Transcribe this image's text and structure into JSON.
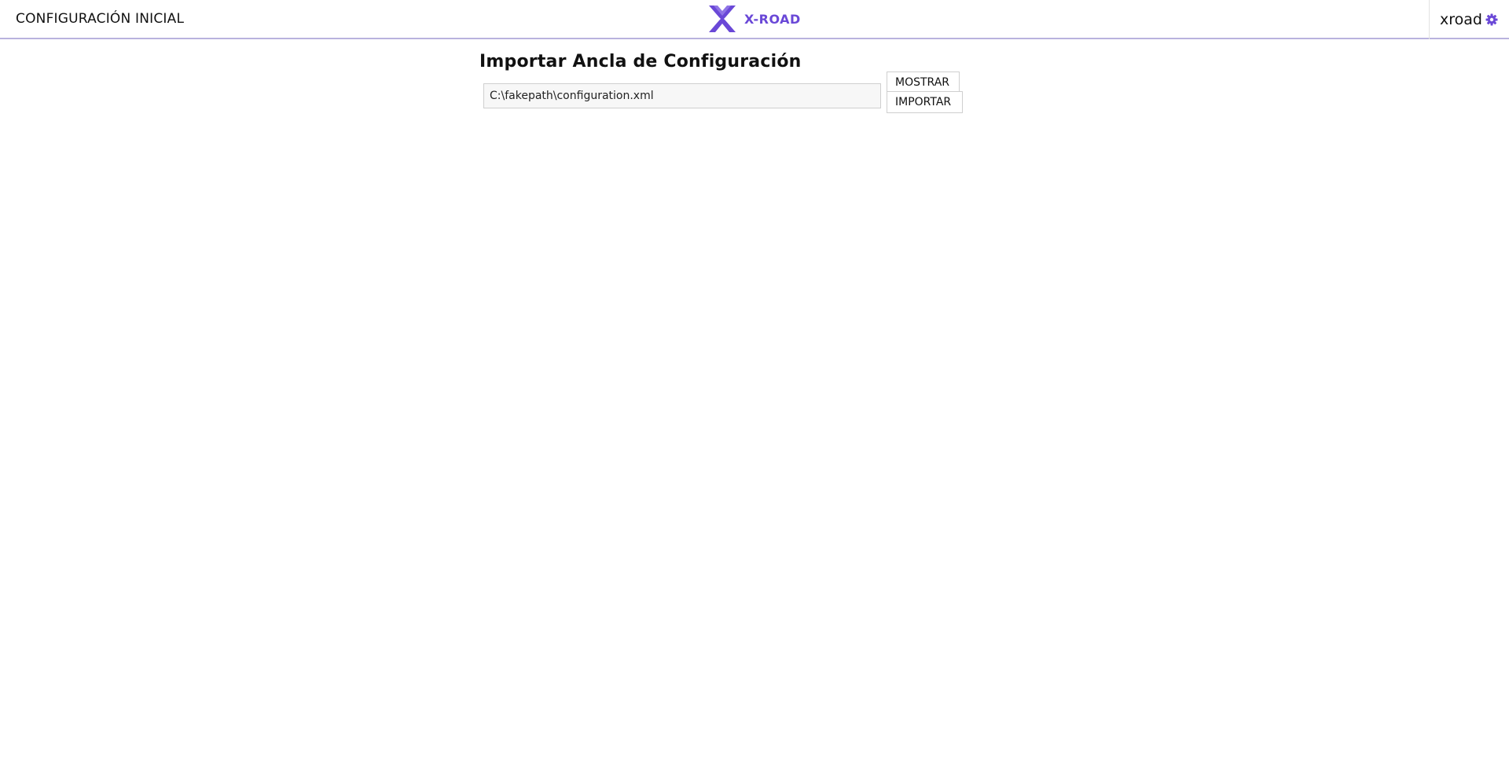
{
  "header": {
    "title": "CONFIGURACIÓN INICIAL",
    "logo": {
      "text": "X-ROAD",
      "icon": "x-road-logo-icon",
      "color": "#6a48d7"
    },
    "user": {
      "name": "xroad",
      "icon": "gear-icon"
    }
  },
  "main": {
    "heading": "Importar Ancla de Configuración",
    "file_input": {
      "value": "C:\\fakepath\\configuration.xml"
    },
    "buttons": {
      "show_label": "MOSTRAR",
      "import_label": "IMPORTAR"
    }
  },
  "colors": {
    "accent": "#6a48d7",
    "header_border": "#b9b2de"
  }
}
